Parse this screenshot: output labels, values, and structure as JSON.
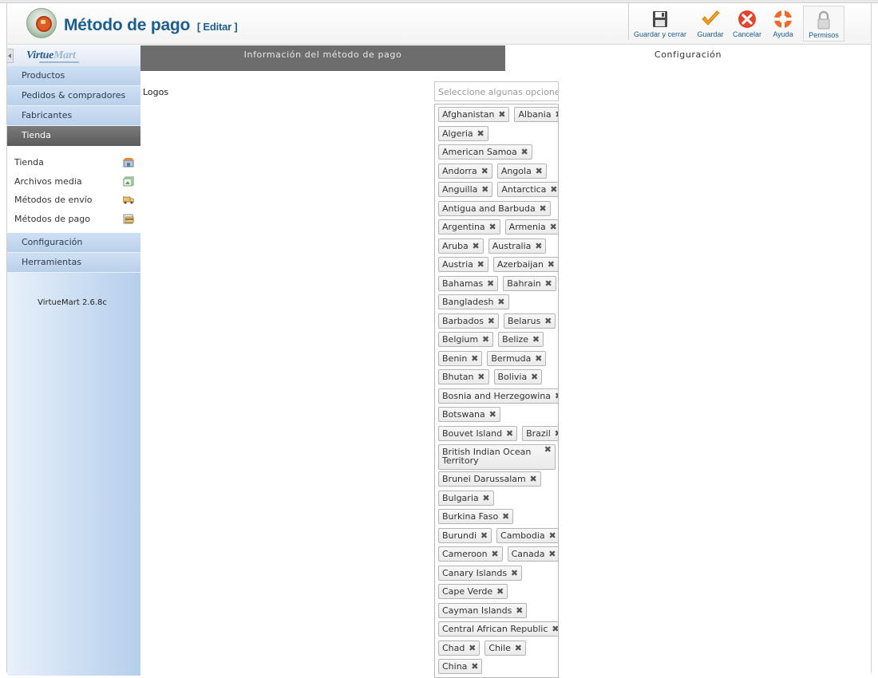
{
  "header": {
    "title": "Método de pago",
    "title_suffix": "[ Editar ]",
    "toolbar": [
      {
        "label": "Guardar y cerrar",
        "icon": "save-disk-icon"
      },
      {
        "label": "Guardar",
        "icon": "checkmark-icon"
      },
      {
        "label": "Cancelar",
        "icon": "cancel-icon"
      },
      {
        "label": "Ayuda",
        "icon": "lifebuoy-help-icon"
      },
      {
        "label": "Permisos",
        "icon": "lock-icon"
      }
    ]
  },
  "sidebar": {
    "logo": {
      "main": "Virtue",
      "accent": "Mart"
    },
    "menu_top": [
      "Productos",
      "Pedidos & compradores",
      "Fabricantes",
      "Tienda"
    ],
    "active_menu": "Tienda",
    "submenu": [
      {
        "label": "Tienda",
        "icon": "shop-icon"
      },
      {
        "label": "Archivos media",
        "icon": "media-files-icon"
      },
      {
        "label": "Métodos de envío",
        "icon": "shipping-truck-icon"
      },
      {
        "label": "Métodos de pago",
        "icon": "payment-card-icon"
      }
    ],
    "menu_bottom": [
      "Configuración",
      "Herramientas"
    ],
    "version": "VirtueMart 2.6.8c"
  },
  "tabs": [
    {
      "label": "Información del método de pago",
      "active": true
    },
    {
      "label": "Configuración",
      "active": false
    }
  ],
  "form": {
    "logos_label": "Logos",
    "select_placeholder": "Seleccione algunas opciones",
    "selected_rows": [
      [
        "Afghanistan",
        "Albania"
      ],
      [
        "Algeria"
      ],
      [
        "American Samoa"
      ],
      [
        "Andorra",
        "Angola"
      ],
      [
        "Anguilla",
        "Antarctica"
      ],
      [
        "Antigua and Barbuda"
      ],
      [
        "Argentina",
        "Armenia"
      ],
      [
        "Aruba",
        "Australia"
      ],
      [
        "Austria",
        "Azerbaijan"
      ],
      [
        "Bahamas",
        "Bahrain"
      ],
      [
        "Bangladesh"
      ],
      [
        "Barbados",
        "Belarus"
      ],
      [
        "Belgium",
        "Belize"
      ],
      [
        "Benin",
        "Bermuda"
      ],
      [
        "Bhutan",
        "Bolivia"
      ],
      [
        "Bosnia and Herzegowina"
      ],
      [
        "Botswana"
      ],
      [
        "Bouvet Island",
        "Brazil"
      ],
      [
        "British Indian Ocean Territory"
      ],
      [
        "Brunei Darussalam"
      ],
      [
        "Bulgaria"
      ],
      [
        "Burkina Faso"
      ],
      [
        "Burundi",
        "Cambodia"
      ],
      [
        "Cameroon",
        "Canada"
      ],
      [
        "Canary Islands"
      ],
      [
        "Cape Verde"
      ],
      [
        "Cayman Islands"
      ],
      [
        "Central African Republic"
      ],
      [
        "Chad",
        "Chile"
      ],
      [
        "China"
      ]
    ],
    "remove_glyph": "✖"
  }
}
